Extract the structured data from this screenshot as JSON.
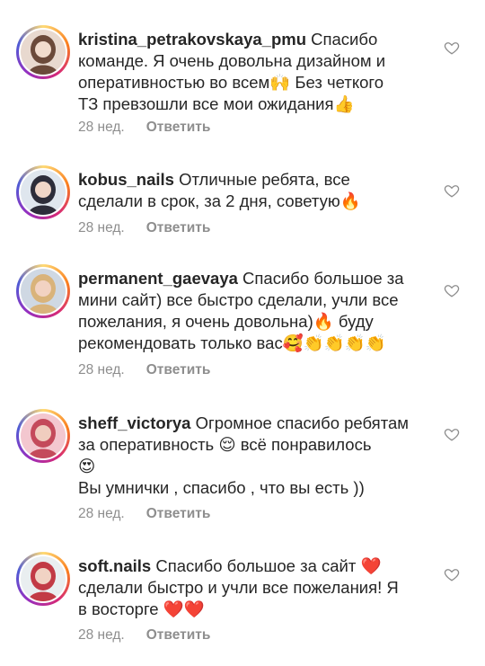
{
  "comments": [
    {
      "username": "kristina_petrakovskaya_pmu",
      "text": "Спасибо\nкоманде. Я очень довольна дизайном и\nоперативностью  во всем🙌 Без четкого\nТЗ превзошли все мои ожидания👍",
      "age": "28 нед.",
      "reply": "Ответить",
      "avatar_colors": [
        "#e8d9cf",
        "#6b4a3a",
        "#f1dccd"
      ]
    },
    {
      "username": "kobus_nails",
      "text": "Отличные ребята, все\nсделали в срок, за 2 дня, советую🔥",
      "age": "28 нед.",
      "reply": "Ответить",
      "avatar_colors": [
        "#dfe6ee",
        "#2d2d3a",
        "#f0d6c8"
      ]
    },
    {
      "username": "permanent_gaevaya",
      "text": "Спасибо большое за\nмини сайт) все быстро сделали, учли все\nпожелания, я очень довольна)🔥 буду\nрекомендовать только вас🥰👏👏👏👏",
      "age": "28 нед.",
      "reply": "Ответить",
      "avatar_colors": [
        "#cfd8e3",
        "#d9b37a",
        "#f2d2c2"
      ]
    },
    {
      "username": "sheff_victorya",
      "text": "Огромное спасибо ребятам\nза оперативность 😌 всё понравилось\n😍\nВы умнички , спасибо , что вы есть ))",
      "age": "28 нед.",
      "reply": "Ответить",
      "avatar_colors": [
        "#f3c7cf",
        "#c44a5b",
        "#f0cdbf"
      ]
    },
    {
      "username": "soft.nails",
      "text": "Спасибо большое за сайт ❤️\nсделали быстро и учли все пожелания! Я\nв восторге ❤️❤️",
      "age": "28 нед.",
      "reply": "Ответить",
      "avatar_colors": [
        "#e9eef0",
        "#c23a45",
        "#f1d3c4"
      ]
    }
  ]
}
